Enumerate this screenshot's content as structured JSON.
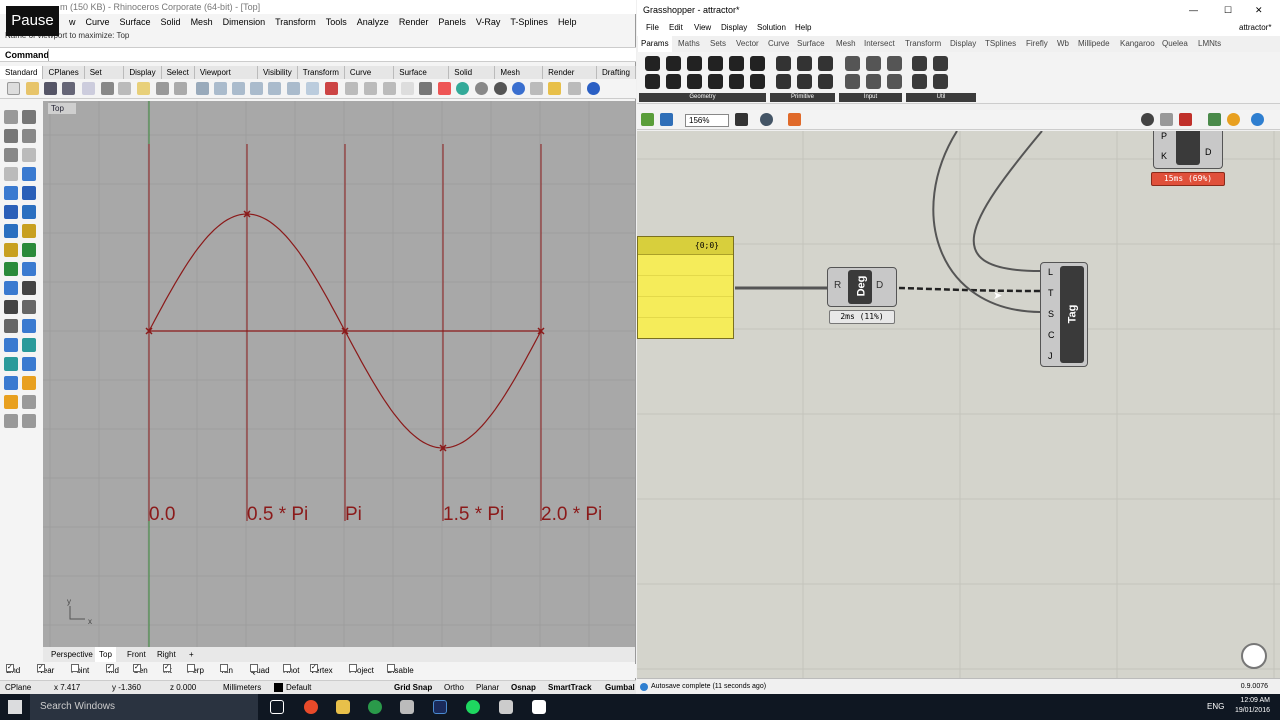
{
  "rhino": {
    "title": "m (150 KB) - Rhinoceros Corporate (64-bit) - [Top]",
    "pause_label": "Pause",
    "menu": [
      "w",
      "Curve",
      "Surface",
      "Solid",
      "Mesh",
      "Dimension",
      "Transform",
      "Tools",
      "Analyze",
      "Render",
      "Panels",
      "V-Ray",
      "T-Splines",
      "Help"
    ],
    "command_history": "Name of viewport to maximize: Top",
    "command_label": "Command:",
    "toolbar_tabs": [
      "Standard",
      "CPlanes",
      "Set View",
      "Display",
      "Select",
      "Viewport Layout",
      "Visibility",
      "Transform",
      "Curve Tools",
      "Surface Tools",
      "Solid Tools",
      "Mesh Tools",
      "Render Tools",
      "Drafting"
    ],
    "viewport_label": "Top",
    "axis_labels": [
      "0.0",
      "0.5 * Pi",
      "Pi",
      "1.5 * Pi",
      "2.0 * Pi"
    ],
    "axis_y": "y",
    "axis_x": "x",
    "viewport_tabs": [
      "Perspective",
      "Top",
      "Front",
      "Right",
      "+"
    ],
    "osnaps": [
      {
        "label": "End",
        "checked": true
      },
      {
        "label": "Near",
        "checked": true
      },
      {
        "label": "Point",
        "checked": false
      },
      {
        "label": "Mid",
        "checked": true
      },
      {
        "label": "Cen",
        "checked": true
      },
      {
        "label": "Int",
        "checked": true
      },
      {
        "label": "Perp",
        "checked": false
      },
      {
        "label": "Tan",
        "checked": false
      },
      {
        "label": "Quad",
        "checked": false
      },
      {
        "label": "Knot",
        "checked": false
      },
      {
        "label": "Vertex",
        "checked": true
      },
      {
        "label": "Project",
        "checked": false
      },
      {
        "label": "Disable",
        "checked": false
      }
    ],
    "status": {
      "cplane": "CPlane",
      "x": "x 7.417",
      "y": "y -1.360",
      "z": "z 0.000",
      "units": "Millimeters",
      "layer": "Default",
      "grid_snap": "Grid Snap",
      "ortho": "Ortho",
      "planar": "Planar",
      "osnap": "Osnap",
      "smarttrack": "SmartTrack",
      "gumball": "Gumbal"
    }
  },
  "grasshopper": {
    "title": "Grasshopper - attractor*",
    "doc_name": "attractor*",
    "menu": [
      "File",
      "Edit",
      "View",
      "Display",
      "Solution",
      "Help"
    ],
    "tabs": [
      "Params",
      "Maths",
      "Sets",
      "Vector",
      "Curve",
      "Surface",
      "Mesh",
      "Intersect",
      "Transform",
      "Display",
      "TSplines",
      "Firefly",
      "Wb",
      "Millipede",
      "Kangaroo",
      "Quelea",
      "LMNts"
    ],
    "groups": [
      "Geometry",
      "Primitive",
      "Input",
      "Util"
    ],
    "zoom": "156%",
    "panel_text": "{0;0}",
    "deg": {
      "name": "Deg",
      "input": "R",
      "output": "D",
      "timing": "2ms (11%)"
    },
    "tag": {
      "name": "Tag",
      "inputs": [
        "L",
        "T",
        "S",
        "C",
        "J"
      ]
    },
    "top_comp": {
      "inputs": [
        "P",
        "K"
      ],
      "output": "D",
      "timing": "15ms (69%)"
    },
    "status": "Autosave complete (11 seconds ago)",
    "version": "0.9.0076"
  },
  "taskbar": {
    "search": "Search Windows",
    "lang": "ENG",
    "time": "12:09 AM",
    "date": "19/01/2016"
  },
  "colors": {
    "curve": "#8b1a1a",
    "panel": "#f5ec5a",
    "timing_bad": "#e0503a",
    "viewport_bg": "#a8a8a8",
    "canvas_bg": "#d4d4cc"
  }
}
